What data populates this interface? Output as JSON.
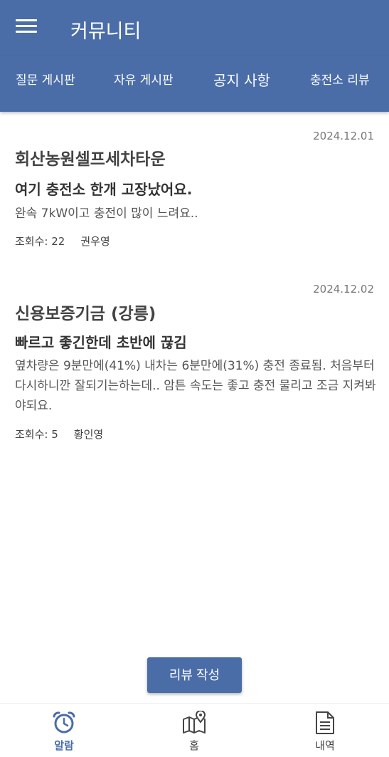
{
  "appbar": {
    "title": "커뮤니티",
    "menu_icon": "hamburger-menu-icon"
  },
  "tabs": [
    {
      "label": "질문 게시판"
    },
    {
      "label": "자유 게시판"
    },
    {
      "label": "공지 사항"
    },
    {
      "label": "충전소 리뷰"
    }
  ],
  "posts": [
    {
      "date": "2024.12.01",
      "place": "회산농원셀프세차타운",
      "title": "여기 충전소 한개 고장났어요.",
      "body": "완속 7kW이고 충전이 많이 느려요..",
      "views": "조회수: 22",
      "author": "권우영"
    },
    {
      "date": "2024.12.02",
      "place": "신용보증기금 (강릉)",
      "title": "빠르고 좋긴한데 초반에 끊김",
      "body": "옆차량은 9분만에(41%) 내차는 6분만에(31%) 충전 종료됨. 처음부터 다시하니깐 잘되기는하는데.. 암튼 속도는 좋고 충전 물리고 조금 지켜봐야되요.",
      "views": "조회수: 5",
      "author": "황인영"
    }
  ],
  "write_button": {
    "label": "리뷰 작성"
  },
  "bottom_nav": [
    {
      "label": "알람",
      "icon": "alarm-clock-icon",
      "active": true
    },
    {
      "label": "홈",
      "icon": "map-icon",
      "active": false
    },
    {
      "label": "내역",
      "icon": "document-icon",
      "active": false
    }
  ],
  "colors": {
    "primary": "#4a6da8",
    "background": "#ffffff"
  }
}
